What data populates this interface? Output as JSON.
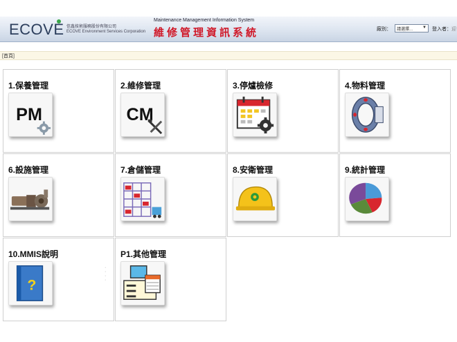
{
  "header": {
    "logo": "ECOVE",
    "company_zh": "信鑫技術服務股份有限公司",
    "company_en": "ECOVE Environment Services Corporation",
    "system_en": "Maintenance Management Information System",
    "system_zh": "維修管理資訊系統",
    "category_label": "廠別：",
    "category_value": "請選擇...",
    "login_label": "登入者：",
    "login_extra": "迎"
  },
  "breadcrumb": "[首頁]",
  "menu": [
    {
      "label": "1.保養管理",
      "icon": "pm-icon"
    },
    {
      "label": "2.維修管理",
      "icon": "cm-icon"
    },
    {
      "label": "3.停爐檢修",
      "icon": "calendar-gear-icon"
    },
    {
      "label": "4.物料管理",
      "icon": "bearing-icon"
    },
    {
      "label": "6.設施管理",
      "icon": "pump-icon"
    },
    {
      "label": "7.倉儲管理",
      "icon": "warehouse-icon"
    },
    {
      "label": "8.安衛管理",
      "icon": "helmet-icon"
    },
    {
      "label": "9.統計管理",
      "icon": "pie-chart-icon"
    },
    {
      "label": "10.MMIS說明",
      "icon": "help-book-icon"
    },
    {
      "label": "P1.其他管理",
      "icon": "computer-icon"
    }
  ],
  "icon_text": {
    "pm": "PM",
    "cm": "CM",
    "help": "?"
  },
  "colors": {
    "header_title": "#d01828",
    "brand": "#2c3e5c",
    "accent_green": "#3aa64a"
  }
}
